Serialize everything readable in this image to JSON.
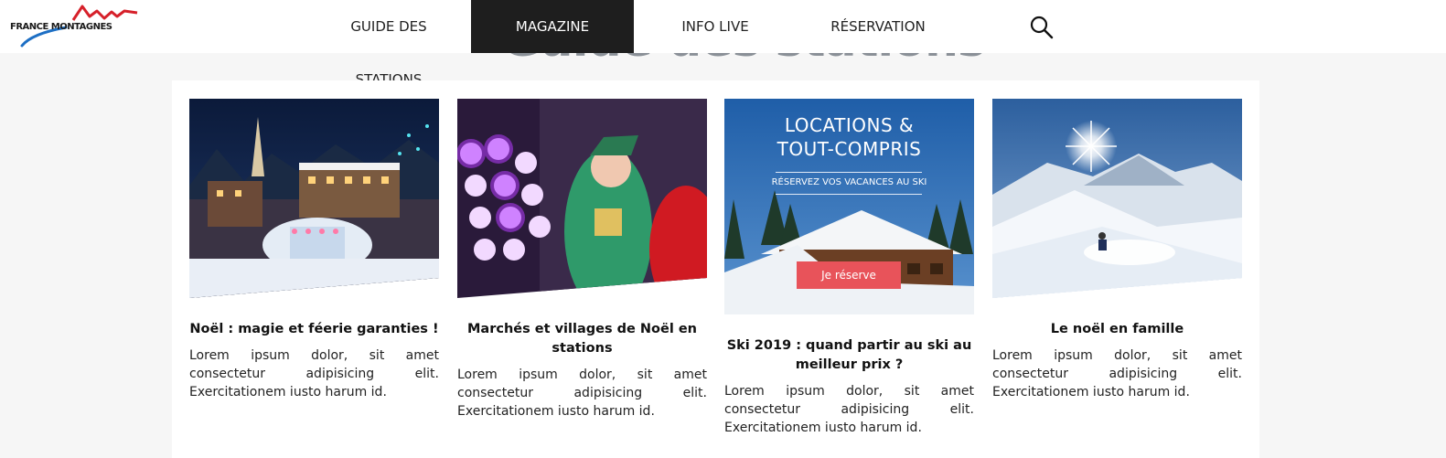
{
  "header": {
    "logo_text": "FRANCE MONTAGNES",
    "nav": {
      "guide": "GUIDE DES STATIONS",
      "magazine": "MAGAZINE",
      "info": "INFO LIVE",
      "reservation": "RÉSERVATION"
    },
    "active_nav": "magazine"
  },
  "background_title": "Guide des stations",
  "cards": [
    {
      "title": "Noël : magie et féerie garanties !",
      "text": "Lorem ipsum dolor, sit amet consectetur adipisicing elit. Exercitationem iusto harum id."
    },
    {
      "title": "Marchés et villages de Noël en stations",
      "text": "Lorem ipsum dolor, sit amet consectetur adipisicing elit. Exercitationem iusto harum id."
    },
    {
      "title": "Ski 2019 : quand partir au ski au meilleur prix ?",
      "text": "Lorem ipsum dolor, sit amet consectetur adipisicing elit. Exercitationem iusto harum id.",
      "ad": {
        "line1": "LOCATIONS &",
        "line2": "TOUT-COMPRIS",
        "subtitle": "RÉSERVEZ VOS VACANCES AU SKI",
        "button": "Je réserve"
      }
    },
    {
      "title": "Le noël en famille",
      "text": "Lorem ipsum dolor, sit amet consectetur adipisicing elit. Exercitationem iusto harum id."
    }
  ],
  "colors": {
    "nav_active_bg": "#1e1e1e",
    "ad_button": "#e8535a",
    "logo_red": "#d6202a",
    "logo_blue": "#1d6fc4"
  },
  "icons": {
    "search": "search-icon"
  }
}
